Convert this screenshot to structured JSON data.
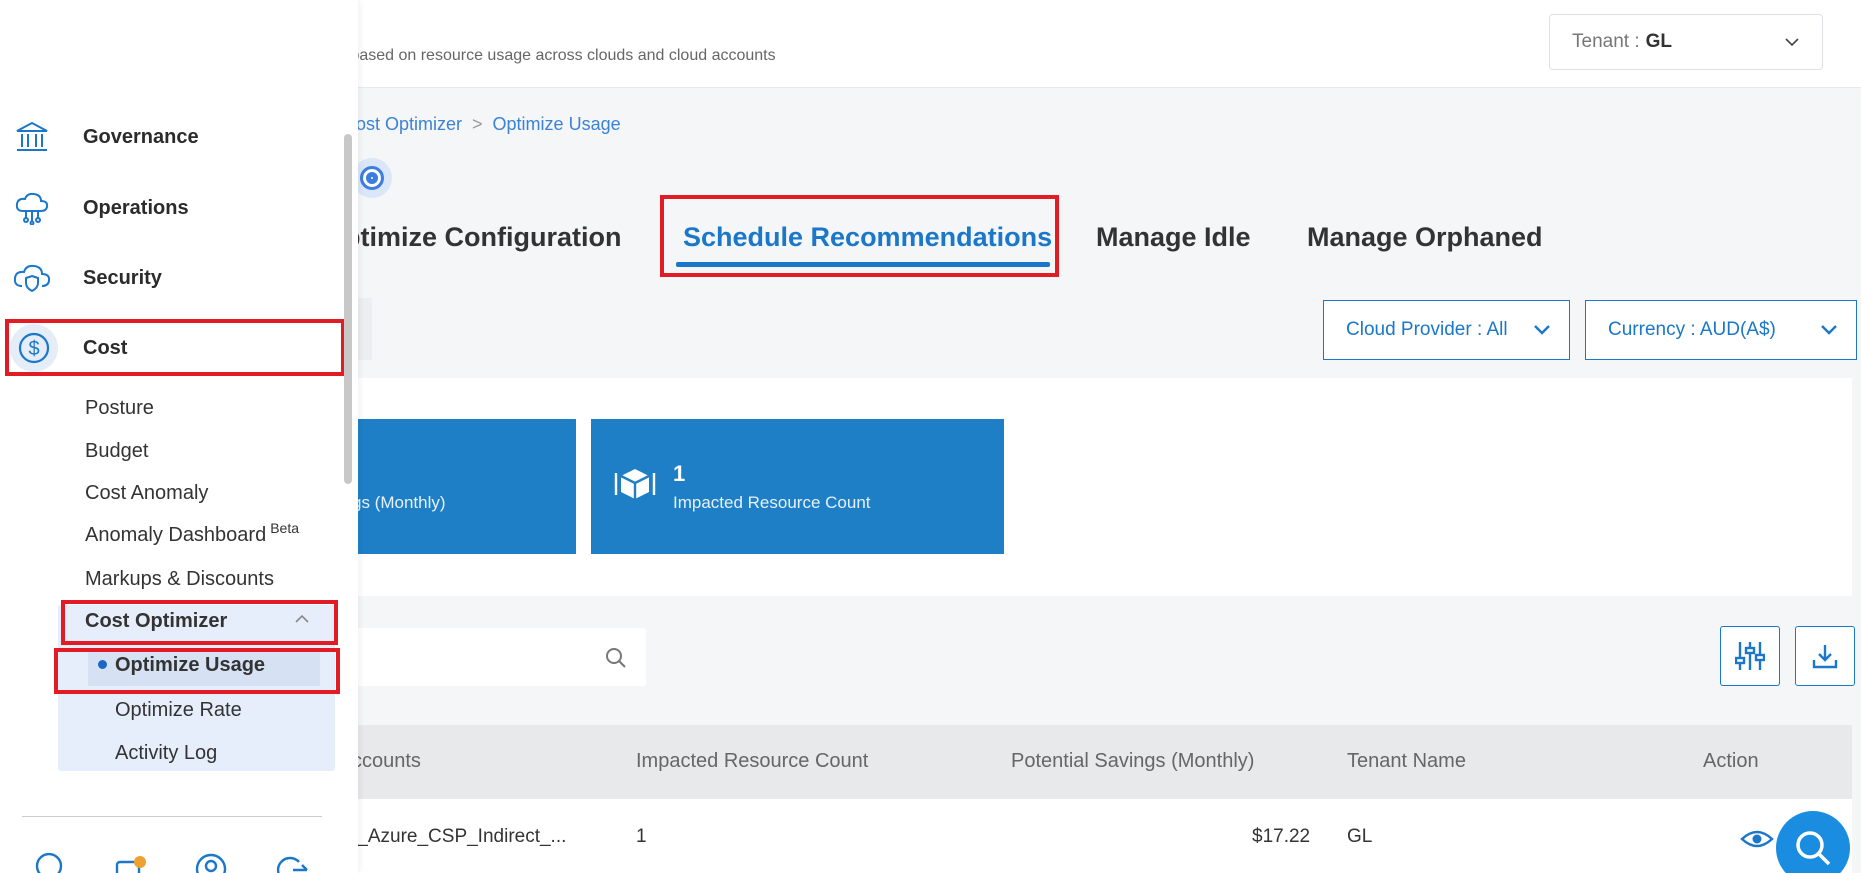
{
  "header": {
    "subtitle": "s based on resource usage across clouds and cloud accounts",
    "tenant_label": "Tenant :",
    "tenant_value": "GL"
  },
  "breadcrumb": {
    "items": [
      "ost Optimizer",
      "Optimize Usage"
    ]
  },
  "tabs": [
    {
      "label": "ptimize Configuration",
      "active": false
    },
    {
      "label": "Schedule Recommendations",
      "active": true
    },
    {
      "label": "Manage Idle",
      "active": false
    },
    {
      "label": "Manage Orphaned",
      "active": false
    }
  ],
  "filters": {
    "cloud_provider": "Cloud Provider : All",
    "currency": "Currency : AUD(A$)"
  },
  "cards": [
    {
      "value": "",
      "label": "gs (Monthly)"
    },
    {
      "value": "1",
      "label": "Impacted Resource Count"
    }
  ],
  "table": {
    "headers": [
      "ccounts",
      "Impacted Resource Count",
      "Potential Savings (Monthly)",
      "Tenant Name",
      "Action"
    ],
    "rows": [
      {
        "account": "t_Azure_CSP_Indirect_...",
        "count": "1",
        "savings": "$17.22",
        "tenant": "GL"
      }
    ]
  },
  "sidebar": {
    "items": [
      {
        "label": "Governance",
        "icon": "bank-icon"
      },
      {
        "label": "Operations",
        "icon": "cloud-network-icon"
      },
      {
        "label": "Security",
        "icon": "cloud-shield-icon"
      },
      {
        "label": "Cost",
        "icon": "dollar-icon"
      }
    ],
    "cost_sub": [
      "Posture",
      "Budget",
      "Cost Anomaly",
      "Anomaly Dashboard",
      "Markups & Discounts",
      "Cost Optimizer"
    ],
    "beta": "Beta",
    "optimizer_sub": [
      "Optimize Usage",
      "Optimize Rate",
      "Activity Log"
    ]
  },
  "colors": {
    "accent": "#1a77c9",
    "card_bg": "#1e7fc6",
    "highlight": "#e21c24"
  }
}
